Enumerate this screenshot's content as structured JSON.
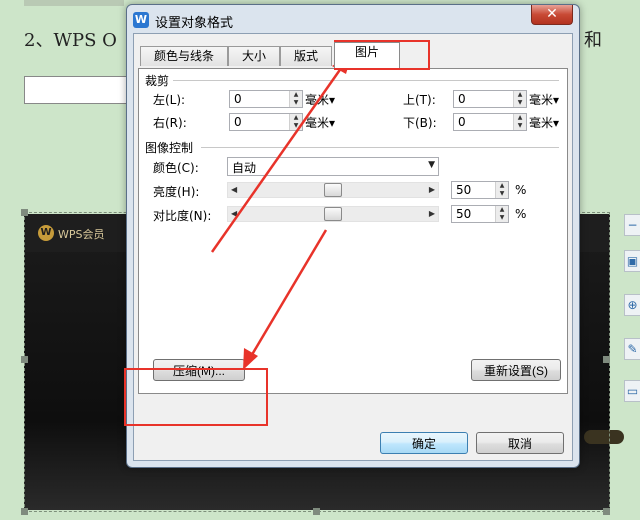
{
  "document": {
    "line_text": "2、WPS O",
    "line_text_right": "和",
    "embedded_badge": "W",
    "embedded_label": "WPS会员"
  },
  "side_tools": [
    "−",
    "▣",
    "⊕",
    "✎",
    "▭"
  ],
  "dialog": {
    "app_icon": "W",
    "title": "设置对象格式",
    "close_label": "✕",
    "tabs": [
      {
        "label": "颜色与线条",
        "active": false
      },
      {
        "label": "大小",
        "active": false
      },
      {
        "label": "版式",
        "active": false
      },
      {
        "label": "图片",
        "active": true
      }
    ],
    "crop": {
      "group_label": "裁剪",
      "left_label": "左(L):",
      "left_value": "0",
      "right_label": "右(R):",
      "right_value": "0",
      "top_label": "上(T):",
      "top_value": "0",
      "bottom_label": "下(B):",
      "bottom_value": "0",
      "unit": "毫米▾"
    },
    "image_control": {
      "group_label": "图像控制",
      "color_label": "颜色(C):",
      "color_value": "自动",
      "brightness_label": "亮度(H):",
      "brightness_value": "50",
      "contrast_label": "对比度(N):",
      "contrast_value": "50",
      "percent": "%"
    },
    "compress_label": "压缩(M)...",
    "reset_label": "重新设置(S)",
    "ok_label": "确定",
    "cancel_label": "取消"
  },
  "colors": {
    "annotation": "#e8332a",
    "document_bg": "#cde5c9",
    "title_icon": "#2b77d1"
  }
}
